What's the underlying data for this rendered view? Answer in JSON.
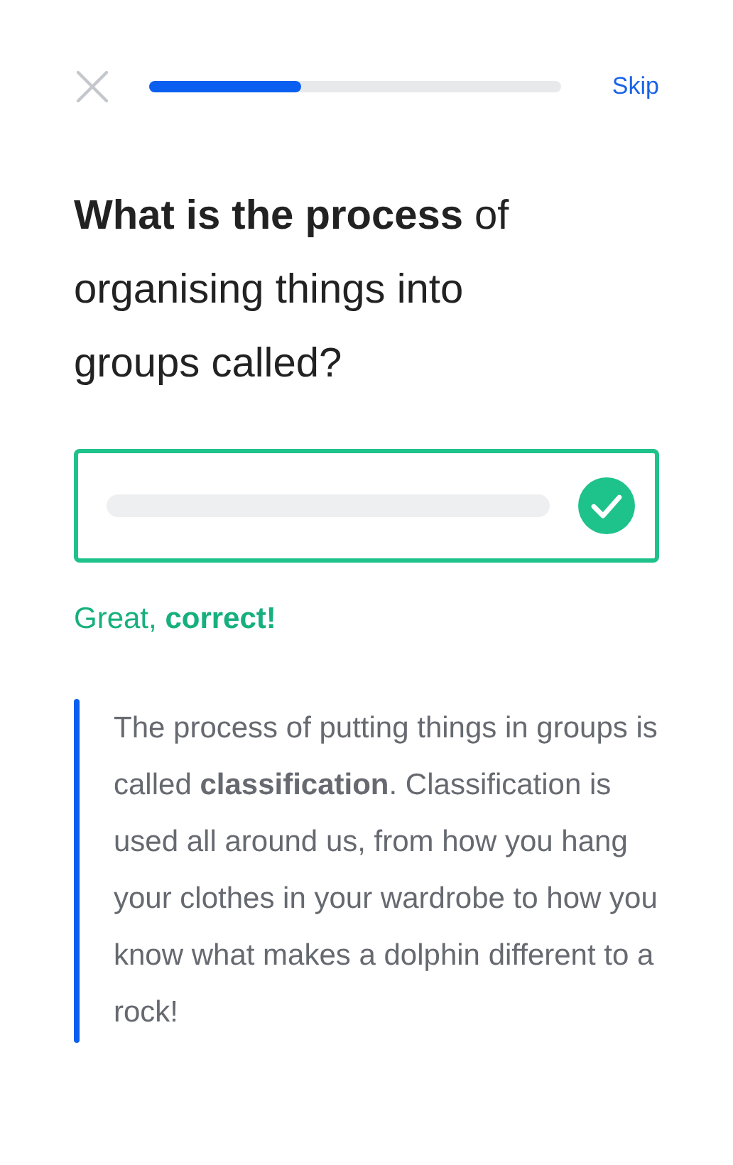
{
  "header": {
    "progress": {
      "level": 0.37
    },
    "skip": "Skip"
  },
  "question": "**What is the process** of organising things into groups called?",
  "answer": {
    "correct": true
  },
  "feedback": "Great, **correct!**",
  "explanation": "The process of putting things in groups is called **classification**. Classification is used all around us, from how you hang your clothes in your wardrobe to how you know what makes a dolphin different to a rock!"
}
